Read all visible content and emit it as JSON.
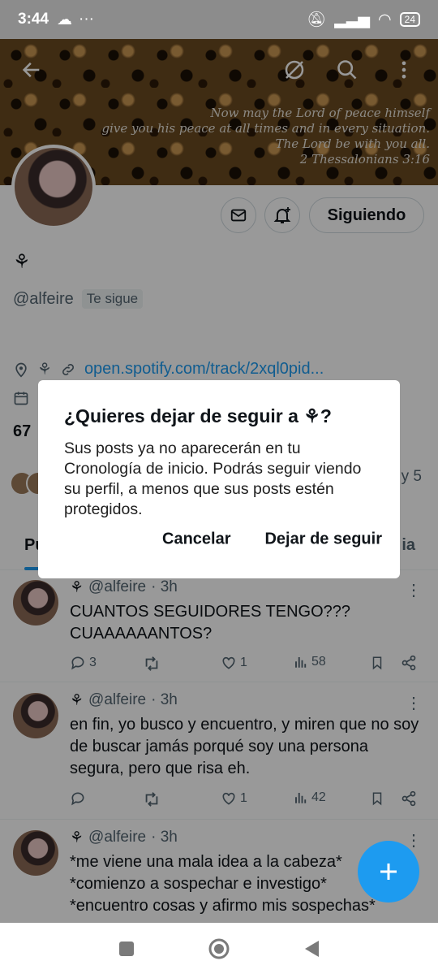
{
  "status_bar": {
    "time": "3:44",
    "battery": "24"
  },
  "banner": {
    "verse_lines": [
      "Now may the Lord of peace himself",
      "give you his peace at all times and in every situation.",
      "The Lord be with you all.",
      "2 Thessalonians 3:16"
    ]
  },
  "profile": {
    "display_name": "⚘",
    "handle": "@alfeire",
    "follows_you": "Te sigue",
    "link": "open.spotify.com/track/2xql0pid...",
    "following_count": "67",
    "following_button": "Siguiendo",
    "followed_by_suffix": "y 5"
  },
  "tabs": {
    "first": "Pu",
    "last": "ia"
  },
  "posts": [
    {
      "name": "⚘",
      "handle": "@alfeire",
      "time": "· 3h",
      "text": "CUANTOS SEGUIDORES TENGO??? CUAAAAAANTOS?",
      "replies": "3",
      "likes": "1",
      "views": "58"
    },
    {
      "name": "⚘",
      "handle": "@alfeire",
      "time": "· 3h",
      "text": "en fin, yo busco y encuentro, y miren que no soy de buscar jamás porqué soy una persona segura, pero que risa eh.",
      "replies": "",
      "likes": "1",
      "views": "42"
    },
    {
      "name": "⚘",
      "handle": "@alfeire",
      "time": "· 3h",
      "lines": [
        "*me viene una mala idea a la cabeza*",
        "*comienzo a sospechar e investigo*",
        "*encuentro cosas y afirmo mis sospechas*"
      ]
    }
  ],
  "dialog": {
    "title": "¿Quieres dejar de seguir a ⚘?",
    "body": "Sus posts ya no aparecerán en tu Cronología de inicio. Podrás seguir viendo su perfil, a menos que sus posts estén protegidos.",
    "cancel": "Cancelar",
    "confirm": "Dejar de seguir"
  },
  "colors": {
    "accent": "#1d9bf0",
    "overlay": "rgba(0,0,0,0.4)"
  },
  "icons": [
    "back-arrow-icon",
    "no-sync-icon",
    "search-icon",
    "more-vertical-icon",
    "message-icon",
    "bell-plus-icon",
    "location-icon",
    "link-icon",
    "calendar-icon",
    "reply-icon",
    "retweet-icon",
    "like-icon",
    "views-icon",
    "bookmark-icon",
    "share-icon",
    "plus-icon"
  ]
}
